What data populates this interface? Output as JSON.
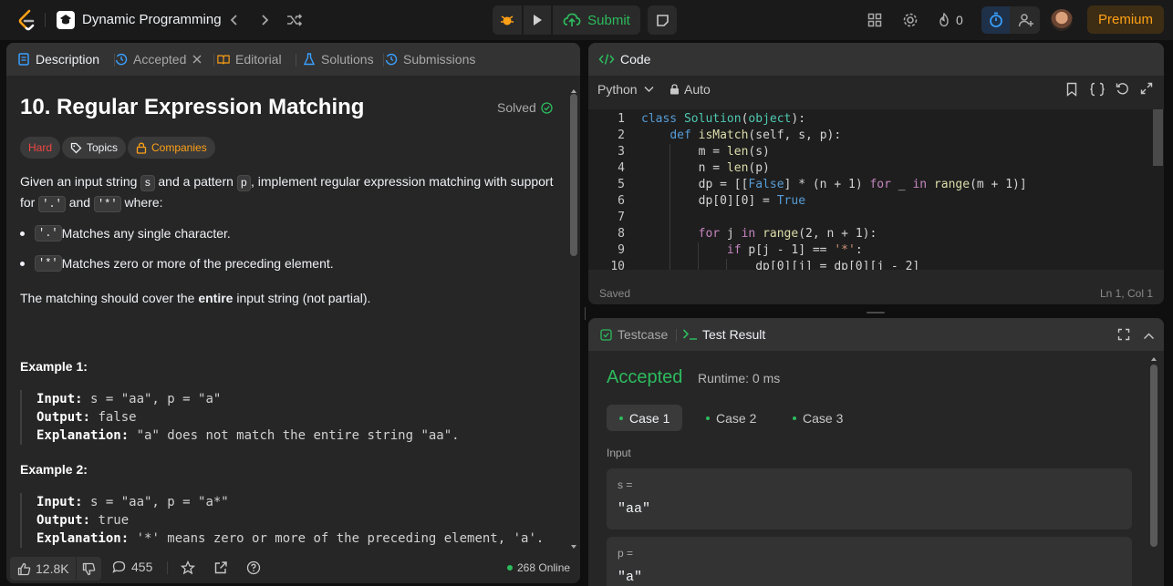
{
  "topbar": {
    "problem_list_title": "Dynamic Programming",
    "submit_label": "Submit",
    "streak_count": "0",
    "premium_label": "Premium",
    "icons": [
      "logo-icon",
      "prev-icon",
      "next-icon",
      "shuffle-icon",
      "debug-icon",
      "run-icon",
      "upload-icon",
      "note-icon",
      "layout-icon",
      "gear-icon",
      "fire-icon",
      "timer-icon",
      "add-user-icon"
    ]
  },
  "left_panel": {
    "tabs": [
      {
        "label": "Description"
      },
      {
        "label": "Accepted"
      },
      {
        "label": "Editorial"
      },
      {
        "label": "Solutions"
      },
      {
        "label": "Submissions"
      }
    ],
    "title": "10. Regular Expression Matching",
    "solved_label": "Solved",
    "chips": {
      "difficulty": "Hard",
      "topics": "Topics",
      "companies": "Companies"
    },
    "intro": {
      "t1": "Given an input string ",
      "c1": "s",
      "t2": " and a pattern ",
      "c2": "p",
      "t3": ", implement regular expression matching with support",
      "t4": "for ",
      "c3": "'.'",
      "t5": " and ",
      "c4": "'*'",
      "t6": " where:"
    },
    "bullets": [
      {
        "code": "'.'",
        "text": " Matches any single character."
      },
      {
        "code": "'*'",
        "text": " Matches zero or more of the preceding element."
      }
    ],
    "entire": {
      "t1": "The matching should cover the ",
      "bold": "entire",
      "t2": " input string (not partial)."
    },
    "examples": [
      {
        "heading": "Example 1:",
        "input_label": "Input:",
        "input": " s = \"aa\", p = \"a\"",
        "output_label": "Output:",
        "output": " false",
        "expl_label": "Explanation:",
        "expl": " \"a\" does not match the entire string \"aa\"."
      },
      {
        "heading": "Example 2:",
        "input_label": "Input:",
        "input": " s = \"aa\", p = \"a*\"",
        "output_label": "Output:",
        "output": " true",
        "expl_label": "Explanation:",
        "expl": " '*' means zero or more of the preceding element, 'a'."
      }
    ],
    "footer": {
      "likes": "12.8K",
      "comments": "455",
      "online": "268 Online"
    }
  },
  "code_panel": {
    "tab": "Code",
    "language": "Python",
    "mode": "Auto",
    "status": "Saved",
    "cursor": "Ln 1, Col 1",
    "line_numbers": [
      "1",
      "2",
      "3",
      "4",
      "5",
      "6",
      "7",
      "8",
      "9",
      "10"
    ]
  },
  "result_panel": {
    "tabs": {
      "testcase": "Testcase",
      "result": "Test Result"
    },
    "verdict": "Accepted",
    "runtime": "Runtime: 0 ms",
    "cases": [
      "Case 1",
      "Case 2",
      "Case 3"
    ],
    "input_label": "Input",
    "vars": [
      {
        "name": "s =",
        "value": "\"aa\""
      },
      {
        "name": "p =",
        "value": "\"a\""
      }
    ]
  },
  "colors": {
    "accent": "#ffa116",
    "accepted": "#2cbb5d",
    "hard": "#ef4743"
  }
}
